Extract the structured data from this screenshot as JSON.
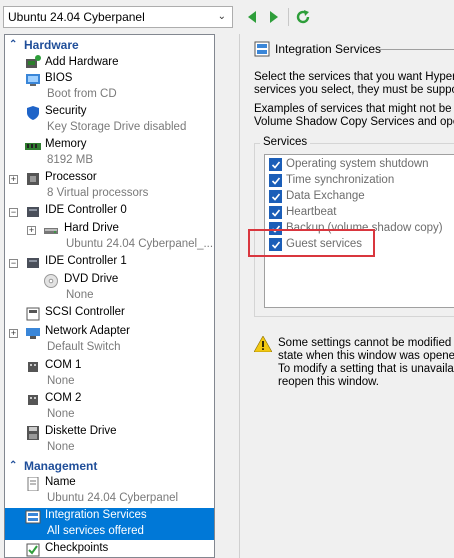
{
  "toolbar": {
    "vm_name": "Ubuntu 24.04 Cyberpanel",
    "icons": [
      "back-arrow-icon",
      "forward-arrow-icon",
      "refresh-icon"
    ],
    "accent_green": "#2e9e3a"
  },
  "left": {
    "hardware_header": "Hardware",
    "management_header": "Management",
    "hardware_items": [
      {
        "label": "Add Hardware",
        "sub": ""
      },
      {
        "label": "BIOS",
        "sub": "Boot from CD"
      },
      {
        "label": "Security",
        "sub": "Key Storage Drive disabled"
      },
      {
        "label": "Memory",
        "sub": "8192 MB"
      },
      {
        "label": "Processor",
        "sub": "8 Virtual processors"
      },
      {
        "label": "IDE Controller 0",
        "sub": ""
      },
      {
        "label": "Hard Drive",
        "sub": "Ubuntu 24.04 Cyberpanel_..."
      },
      {
        "label": "IDE Controller 1",
        "sub": ""
      },
      {
        "label": "DVD Drive",
        "sub": "None"
      },
      {
        "label": "SCSI Controller",
        "sub": ""
      },
      {
        "label": "Network Adapter",
        "sub": "Default Switch"
      },
      {
        "label": "COM 1",
        "sub": "None"
      },
      {
        "label": "COM 2",
        "sub": "None"
      },
      {
        "label": "Diskette Drive",
        "sub": "None"
      }
    ],
    "management_items": [
      {
        "label": "Name",
        "sub": "Ubuntu 24.04 Cyberpanel"
      },
      {
        "label": "Integration Services",
        "sub": "All services offered"
      },
      {
        "label": "Checkpoints",
        "sub": ""
      }
    ],
    "selection_color": "#0078d7"
  },
  "right": {
    "title": "Integration Services",
    "desc_lines": [
      "Select the services that you want Hyper-V",
      "services you select, they must be support",
      "Examples of services that might not be av",
      "Volume Shadow Copy Services and operat"
    ],
    "services_label": "Services",
    "services": [
      {
        "name": "Operating system shutdown",
        "checked": true
      },
      {
        "name": "Time synchronization",
        "checked": true
      },
      {
        "name": "Data Exchange",
        "checked": true
      },
      {
        "name": "Heartbeat",
        "checked": true
      },
      {
        "name": "Backup (volume shadow copy)",
        "checked": true
      },
      {
        "name": "Guest services",
        "checked": true
      }
    ],
    "highlight_color": "#d9363e",
    "note_lines": [
      "Some settings cannot be modified be",
      "state when this window was opened:",
      "To modify a setting that is unavailab",
      "reopen this window."
    ]
  }
}
